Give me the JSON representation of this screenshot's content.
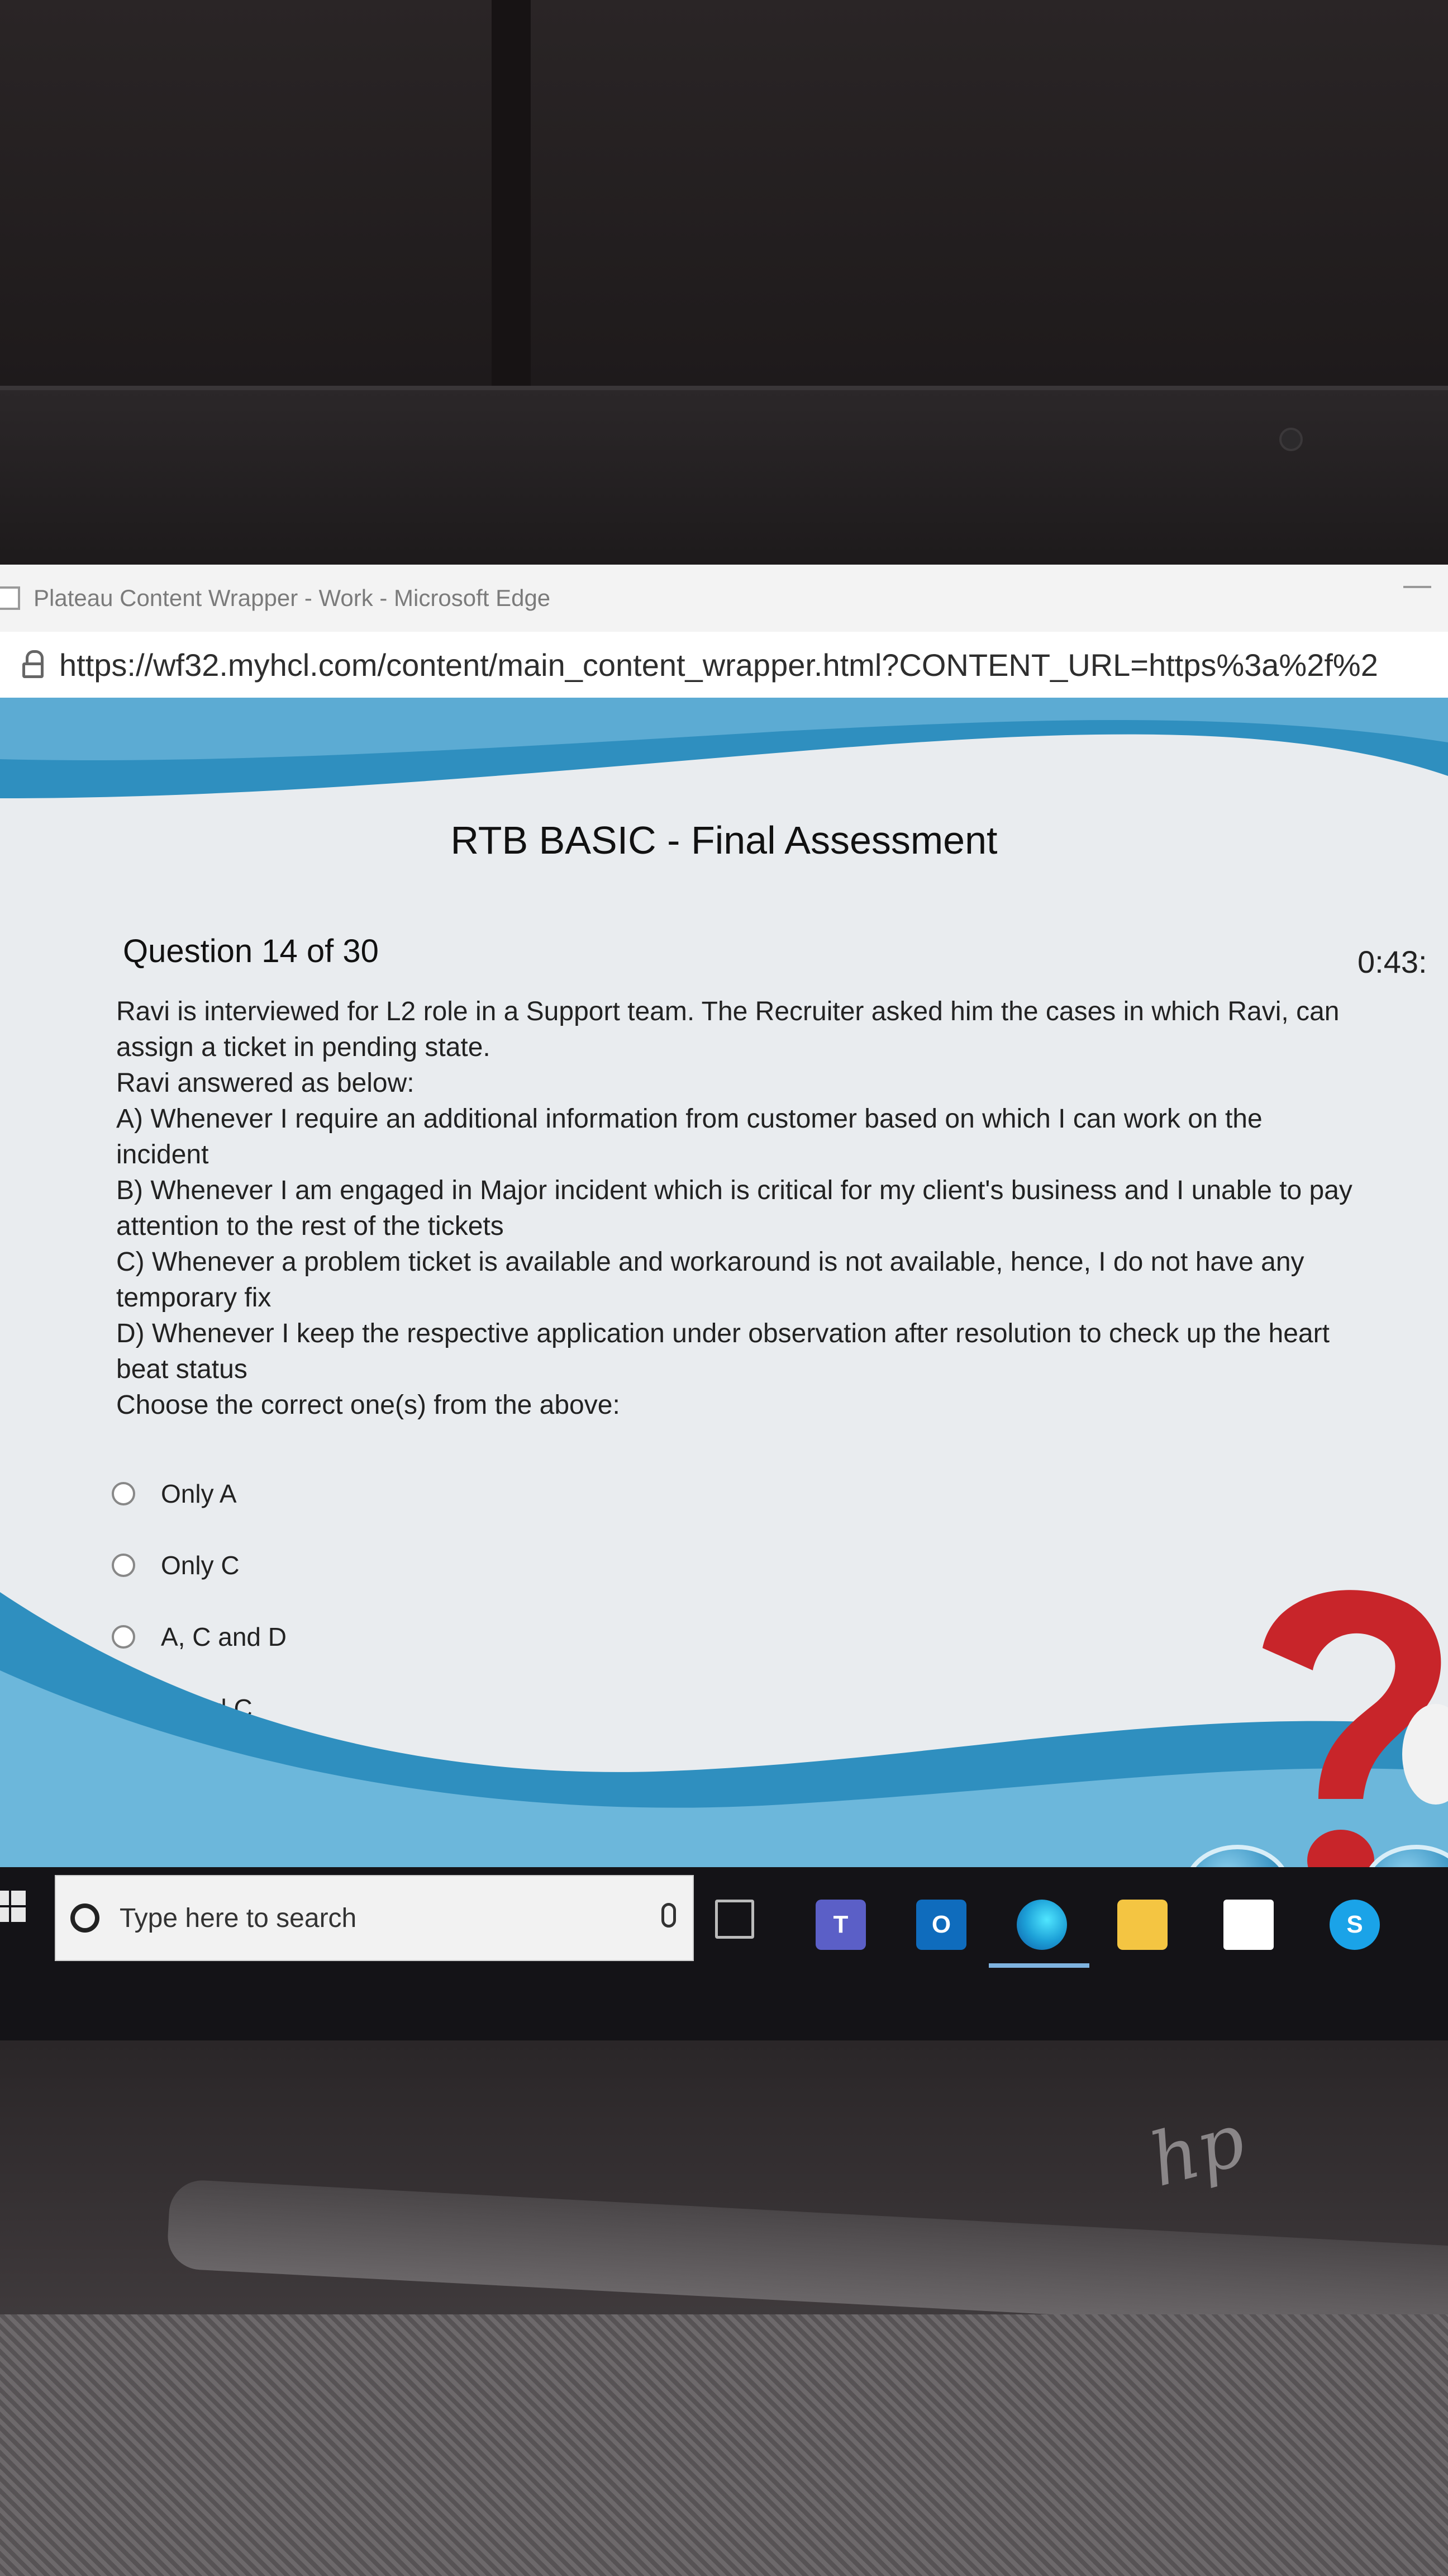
{
  "browser": {
    "window_title": "Plateau Content Wrapper - Work - Microsoft Edge",
    "url": "https://wf32.myhcl.com/content/main_content_wrapper.html?CONTENT_URL=https%3a%2f%2"
  },
  "assessment": {
    "title": "RTB BASIC - Final Assessment",
    "question_number": "Question 14 of 30",
    "timer": "0:43:",
    "question_lines": [
      "Ravi is interviewed for L2 role in a Support team. The Recruiter asked him the cases in which Ravi, can assign a ticket in pending state.",
      "Ravi answered as below:",
      "A) Whenever I require an additional information from customer based on which I can work on the incident",
      "B) Whenever I am engaged in Major incident which is critical for my client's business and I unable to pay attention to the rest of the tickets",
      "C) Whenever a problem ticket is available and workaround is not available, hence, I do not have any temporary fix",
      "D) Whenever I keep the respective application under observation after resolution to check up the heart beat status",
      "Choose the correct one(s) from the above:"
    ],
    "options": [
      {
        "label": "Only A",
        "selected": false
      },
      {
        "label": "Only C",
        "selected": false
      },
      {
        "label": "A, C and D",
        "selected": false
      },
      {
        "label": "A and C",
        "selected": false
      }
    ]
  },
  "navigation": {
    "back_icon": "arrow-left-icon",
    "next_icon": "arrow-right-icon"
  },
  "taskbar": {
    "search_placeholder": "Type here to search",
    "apps": [
      {
        "name": "task-view",
        "glyph": ""
      },
      {
        "name": "teams",
        "glyph": "T",
        "color": "#5b5fc7"
      },
      {
        "name": "outlook",
        "glyph": "O",
        "color": "#0f6cbd"
      },
      {
        "name": "edge",
        "glyph": "",
        "color": "#1da1d8"
      },
      {
        "name": "file-explorer",
        "glyph": "",
        "color": "#f4c542"
      },
      {
        "name": "mail",
        "glyph": "",
        "color": "#ffffff"
      },
      {
        "name": "skype",
        "glyph": "S",
        "color": "#1aa3e8"
      }
    ]
  },
  "colors": {
    "wave_blue": "#2f8fbf",
    "question_mark_red": "#c8252a"
  }
}
